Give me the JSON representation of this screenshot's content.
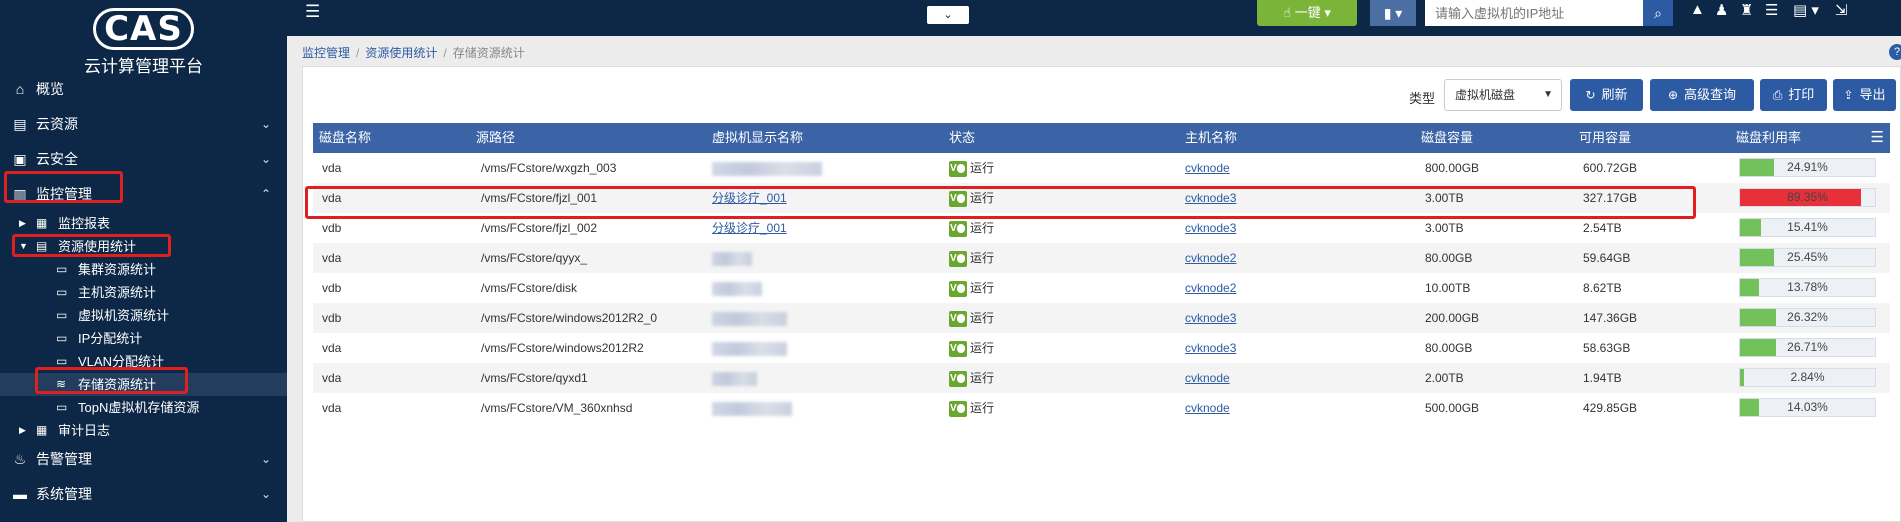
{
  "app": {
    "logo_text": "CAS",
    "title": "云计算管理平台"
  },
  "sidebar": {
    "items": [
      {
        "label": "概览",
        "icon": "home-icon"
      },
      {
        "label": "云资源",
        "icon": "cloud-resource-icon"
      },
      {
        "label": "云安全",
        "icon": "cloud-security-icon"
      },
      {
        "label": "监控管理",
        "icon": "monitor-icon"
      },
      {
        "label": "告警管理",
        "icon": "alarm-icon"
      },
      {
        "label": "系统管理",
        "icon": "system-icon"
      }
    ],
    "monitor_sub": [
      {
        "label": "监控报表",
        "icon": "report-icon"
      },
      {
        "label": "资源使用统计",
        "icon": "stats-icon"
      },
      {
        "label": "审计日志",
        "icon": "log-icon"
      }
    ],
    "stats_leaves": [
      {
        "label": "集群资源统计"
      },
      {
        "label": "主机资源统计"
      },
      {
        "label": "虚拟机资源统计"
      },
      {
        "label": "IP分配统计"
      },
      {
        "label": "VLAN分配统计"
      },
      {
        "label": "存储资源统计"
      },
      {
        "label": "TopN虚拟机存储资源"
      }
    ]
  },
  "header": {
    "onekey_label": "一键",
    "ip_search_placeholder": "请输入虚拟机的IP地址"
  },
  "breadcrumb": [
    "监控管理",
    "资源使用统计",
    "存储资源统计"
  ],
  "toolbar": {
    "type_label": "类型",
    "type_value": "虚拟机磁盘",
    "refresh_label": "刷新",
    "advanced_query_label": "高级查询",
    "print_label": "打印",
    "export_label": "导出"
  },
  "table": {
    "columns": [
      "磁盘名称",
      "源路径",
      "虚拟机显示名称",
      "状态",
      "主机名称",
      "磁盘容量",
      "可用容量",
      "磁盘利用率"
    ],
    "rows": [
      {
        "disk": "vda",
        "path": "/vms/FCstore/wxgzh_003",
        "vm": "",
        "status": "运行",
        "host": "cvknode",
        "capacity": "800.00GB",
        "available": "600.72GB",
        "usage_text": "24.91%",
        "usage": 24.91
      },
      {
        "disk": "vda",
        "path": "/vms/FCstore/fjzl_001",
        "vm": "分级诊疗_001",
        "status": "运行",
        "host": "cvknode3",
        "capacity": "3.00TB",
        "available": "327.17GB",
        "usage_text": "89.35%",
        "usage": 89.35
      },
      {
        "disk": "vdb",
        "path": "/vms/FCstore/fjzl_002",
        "vm": "分级诊疗_001",
        "status": "运行",
        "host": "cvknode3",
        "capacity": "3.00TB",
        "available": "2.54TB",
        "usage_text": "15.41%",
        "usage": 15.41
      },
      {
        "disk": "vda",
        "path": "/vms/FCstore/qyyx_",
        "vm": "",
        "status": "运行",
        "host": "cvknode2",
        "capacity": "80.00GB",
        "available": "59.64GB",
        "usage_text": "25.45%",
        "usage": 25.45
      },
      {
        "disk": "vdb",
        "path": "/vms/FCstore/disk",
        "vm": "",
        "status": "运行",
        "host": "cvknode2",
        "capacity": "10.00TB",
        "available": "8.62TB",
        "usage_text": "13.78%",
        "usage": 13.78
      },
      {
        "disk": "vdb",
        "path": "/vms/FCstore/windows2012R2_0",
        "vm": "",
        "status": "运行",
        "host": "cvknode3",
        "capacity": "200.00GB",
        "available": "147.36GB",
        "usage_text": "26.32%",
        "usage": 26.32
      },
      {
        "disk": "vda",
        "path": "/vms/FCstore/windows2012R2",
        "vm": "",
        "status": "运行",
        "host": "cvknode3",
        "capacity": "80.00GB",
        "available": "58.63GB",
        "usage_text": "26.71%",
        "usage": 26.71
      },
      {
        "disk": "vda",
        "path": "/vms/FCstore/qyxd1",
        "vm": "",
        "status": "运行",
        "host": "cvknode",
        "capacity": "2.00TB",
        "available": "1.94TB",
        "usage_text": "2.84%",
        "usage": 2.84
      },
      {
        "disk": "vda",
        "path": "/vms/FCstore/VM_360xnhsd",
        "vm": "",
        "status": "运行",
        "host": "cvknode",
        "capacity": "500.00GB",
        "available": "429.85GB",
        "usage_text": "14.03%",
        "usage": 14.03
      }
    ]
  },
  "colors": {
    "sidebar_bg": "#0d2747",
    "table_header_bg": "#3b64a6",
    "accent_button": "#2d5ba3",
    "usage_normal": "#73c15a",
    "usage_high": "#e8303a",
    "highlight_border": "#e02020"
  }
}
